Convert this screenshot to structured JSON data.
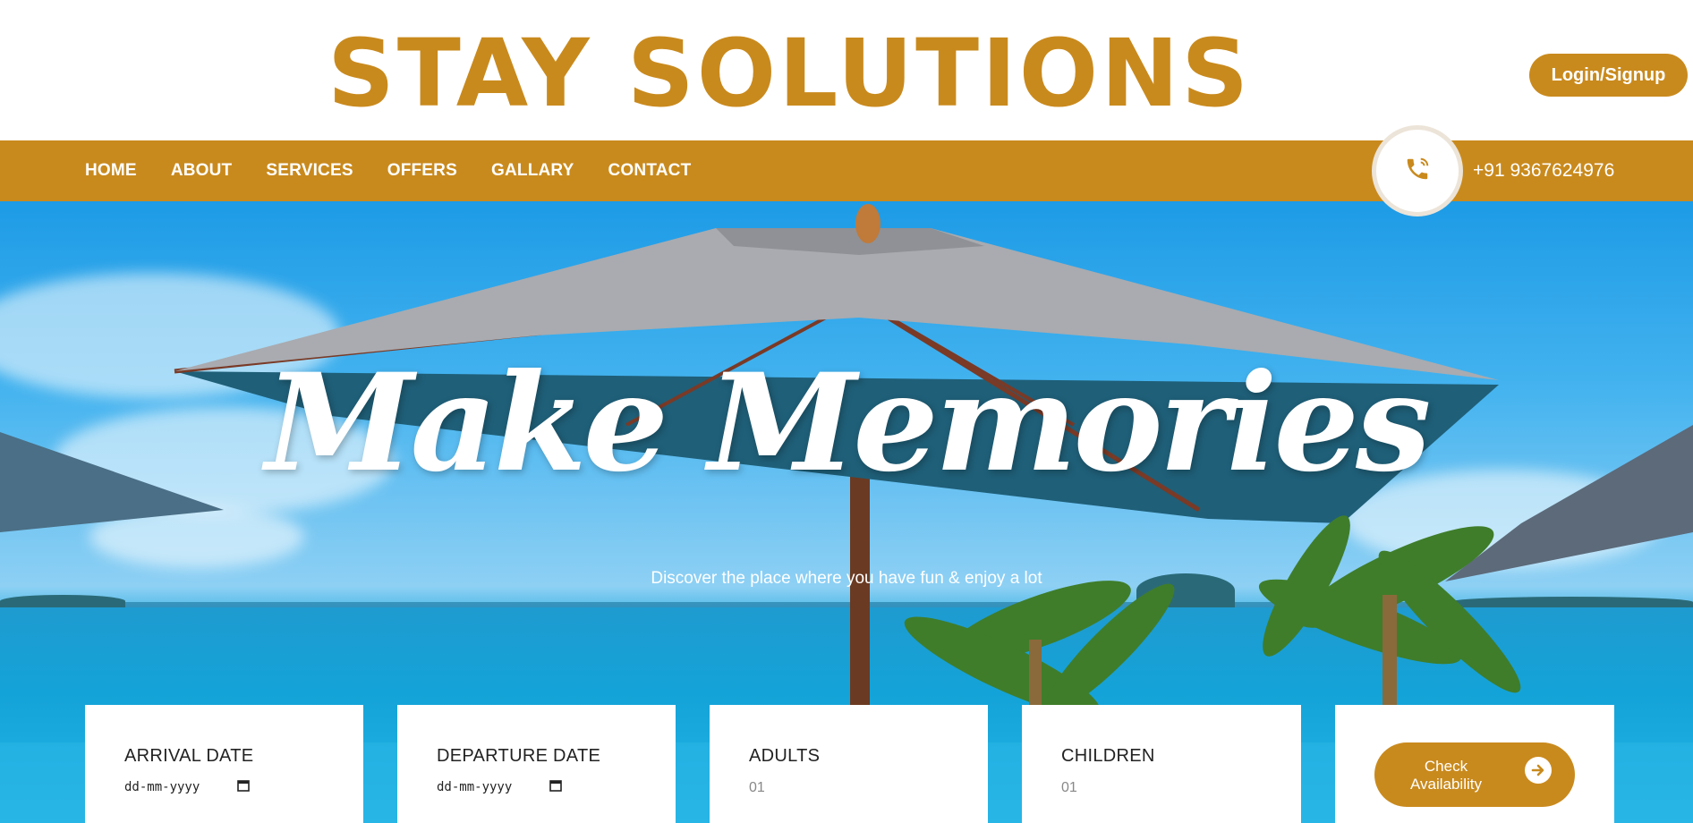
{
  "header": {
    "brand": "STAY SOLUTIONS",
    "login_label": "Login/Signup"
  },
  "nav": {
    "items": [
      "HOME",
      "ABOUT",
      "SERVICES",
      "OFFERS",
      "GALLARY",
      "CONTACT"
    ],
    "phone_number": "+91 9367624976"
  },
  "hero": {
    "title": "Make Memories",
    "subtitle": "Discover the place where you have fun & enjoy a lot"
  },
  "booking": {
    "arrival_label": "ARRIVAL DATE",
    "arrival_placeholder": "dd-mm-yyyy",
    "departure_label": "DEPARTURE DATE",
    "departure_placeholder": "dd-mm-yyyy",
    "adults_label": "ADULTS",
    "adults_value": "01",
    "children_label": "CHILDREN",
    "children_value": "01",
    "check_label": "Check Availability"
  },
  "colors": {
    "accent": "#c98a1d",
    "sky": "#44b3ef",
    "sea": "#14a3d8"
  },
  "icons": [
    "phone-icon",
    "calendar-icon",
    "arrow-right-icon"
  ]
}
